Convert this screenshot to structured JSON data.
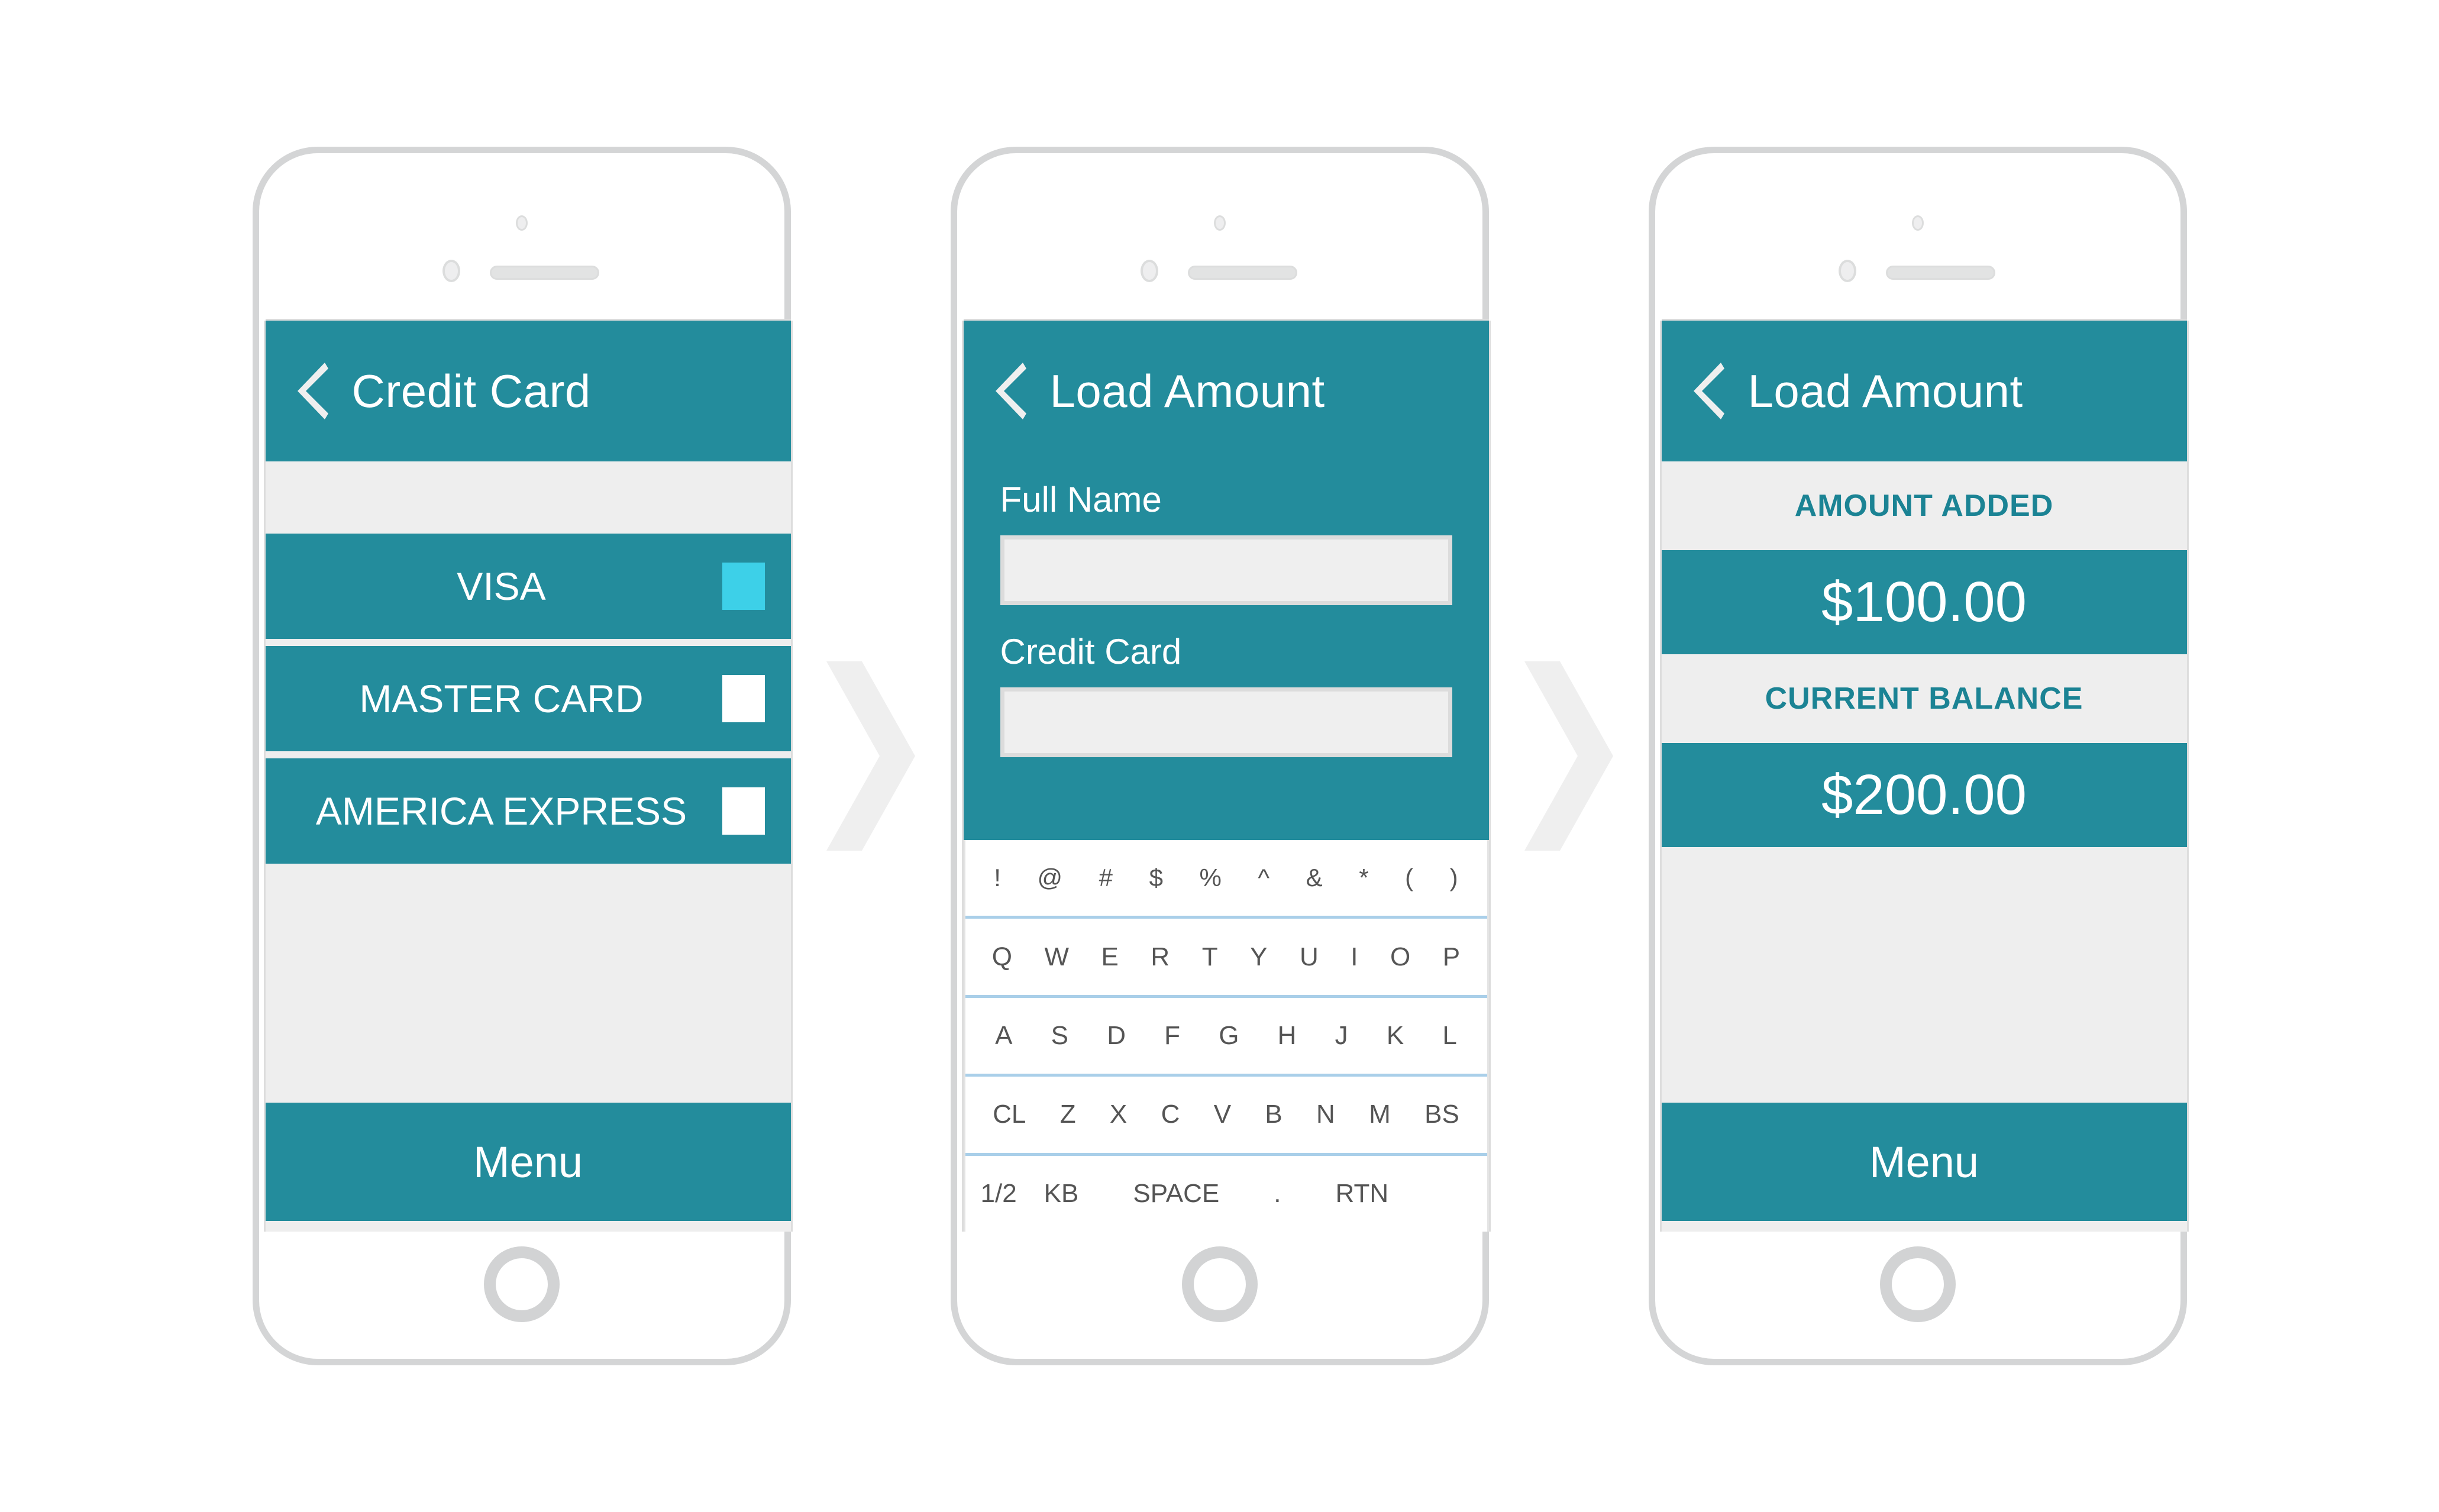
{
  "colors": {
    "teal": "#238C9C",
    "teal_text": "#1B8394",
    "cyan_selected": "#3DD0E8",
    "light_gray": "#eeeeee",
    "frame_gray": "#d4d5d6",
    "key_separator": "#a9cfe9"
  },
  "screens": [
    {
      "id": "credit-card",
      "header": {
        "back_icon": "back-chevron-icon",
        "title": "Credit Card"
      },
      "cards": [
        {
          "label": "VISA",
          "selected": true
        },
        {
          "label": "MASTER CARD",
          "selected": false
        },
        {
          "label": "AMERICA EXPRESS",
          "selected": false
        }
      ],
      "menu_label": "Menu"
    },
    {
      "id": "load-amount-form",
      "header": {
        "back_icon": "back-chevron-icon",
        "title": "Load Amount"
      },
      "fields": [
        {
          "label": "Full Name",
          "value": "",
          "placeholder": ""
        },
        {
          "label": "Credit Card",
          "value": "",
          "placeholder": ""
        }
      ],
      "keyboard": {
        "rows": [
          [
            "!",
            "@",
            "#",
            "$",
            "%",
            "^",
            "&",
            "*",
            "(",
            ")"
          ],
          [
            "Q",
            "W",
            "E",
            "R",
            "T",
            "Y",
            "U",
            "I",
            "O",
            "P"
          ],
          [
            "A",
            "S",
            "D",
            "F",
            "G",
            "H",
            "J",
            "K",
            "L"
          ],
          [
            "CL",
            "Z",
            "X",
            "C",
            "V",
            "B",
            "N",
            "M",
            "BS"
          ],
          [
            "1/2",
            "KB",
            "SPACE",
            ".",
            "RTN"
          ]
        ]
      }
    },
    {
      "id": "load-amount-summary",
      "header": {
        "back_icon": "back-chevron-icon",
        "title": "Load Amount"
      },
      "summary": [
        {
          "label": "AMOUNT ADDED",
          "value": "$100.00"
        },
        {
          "label": "CURRENT BALANCE",
          "value": "$200.00"
        }
      ],
      "menu_label": "Menu"
    }
  ],
  "connectors": [
    {
      "icon": "chevron-right-arrow"
    },
    {
      "icon": "chevron-right-arrow"
    }
  ]
}
